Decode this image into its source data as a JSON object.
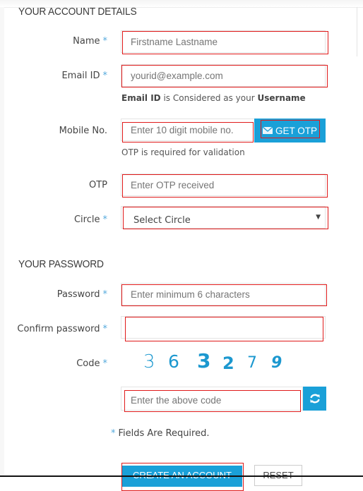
{
  "sections": {
    "account_title": "YOUR ACCOUNT DETAILS",
    "password_title": "YOUR PASSWORD"
  },
  "required_mark": "*",
  "fields": {
    "name": {
      "label": "Name",
      "placeholder": "Firstname Lastname",
      "value": ""
    },
    "email": {
      "label": "Email ID",
      "placeholder": "yourid@example.com",
      "value": ""
    },
    "email_help": {
      "bold1": "Email ID",
      "middle": " is Considered as your ",
      "bold2": "Username"
    },
    "mobile": {
      "label": "Mobile No.",
      "placeholder": "Enter 10 digit mobile no.",
      "value": ""
    },
    "get_otp_label": "GET OTP",
    "mobile_help": "OTP is required for validation",
    "otp": {
      "label": "OTP",
      "placeholder": "Enter OTP received",
      "value": ""
    },
    "circle": {
      "label": "Circle",
      "selected": "Select Circle"
    },
    "password": {
      "label": "Password",
      "placeholder": "Enter minimum 6 characters",
      "value": ""
    },
    "confirm_password": {
      "label": "Confirm password",
      "placeholder": "",
      "value": ""
    },
    "code": {
      "label": "Code",
      "digits": [
        "3",
        "6",
        "3",
        "2",
        "7",
        "9"
      ],
      "placeholder": "Enter the above code",
      "value": ""
    }
  },
  "required_note": "Fields Are Required.",
  "buttons": {
    "create": "CREATE AN ACCOUNT",
    "reset": "RESET"
  },
  "colors": {
    "accent": "#1aa0d8",
    "highlight": "#e01a1a",
    "required": "#54a9dc"
  }
}
